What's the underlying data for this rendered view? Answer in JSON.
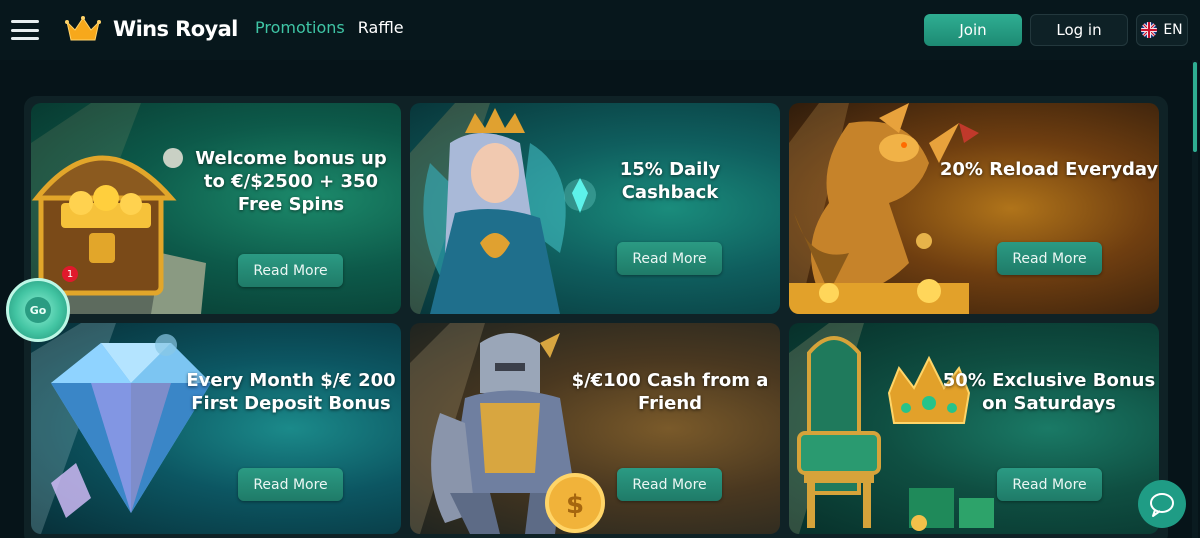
{
  "header": {
    "brand": "Wins Royal",
    "nav": [
      {
        "label": "Promotions",
        "active": true
      },
      {
        "label": "Raffle",
        "active": false
      }
    ],
    "join_label": "Join",
    "login_label": "Log in",
    "language": "EN",
    "accent_color": "#2fae92"
  },
  "promotions": [
    {
      "title": "Welcome bonus up to €/$2500 + 350 Free Spins",
      "cta": "Read More",
      "image": "treasure-chest"
    },
    {
      "title": "15% Daily Cashback",
      "cta": "Read More",
      "image": "fairy-queen"
    },
    {
      "title": "20% Reload Everyday",
      "cta": "Read More",
      "image": "golden-dragon"
    },
    {
      "title": "Every Month $/€ 200 First Deposit Bonus",
      "cta": "Read More",
      "image": "diamond"
    },
    {
      "title": "$/€100 Cash from a Friend",
      "cta": "Read More",
      "image": "knight"
    },
    {
      "title": "50% Exclusive Bonus on Saturdays",
      "cta": "Read More",
      "image": "throne-crown"
    }
  ],
  "widgets": {
    "wheel_label": "Go",
    "wheel_badge": "1"
  }
}
